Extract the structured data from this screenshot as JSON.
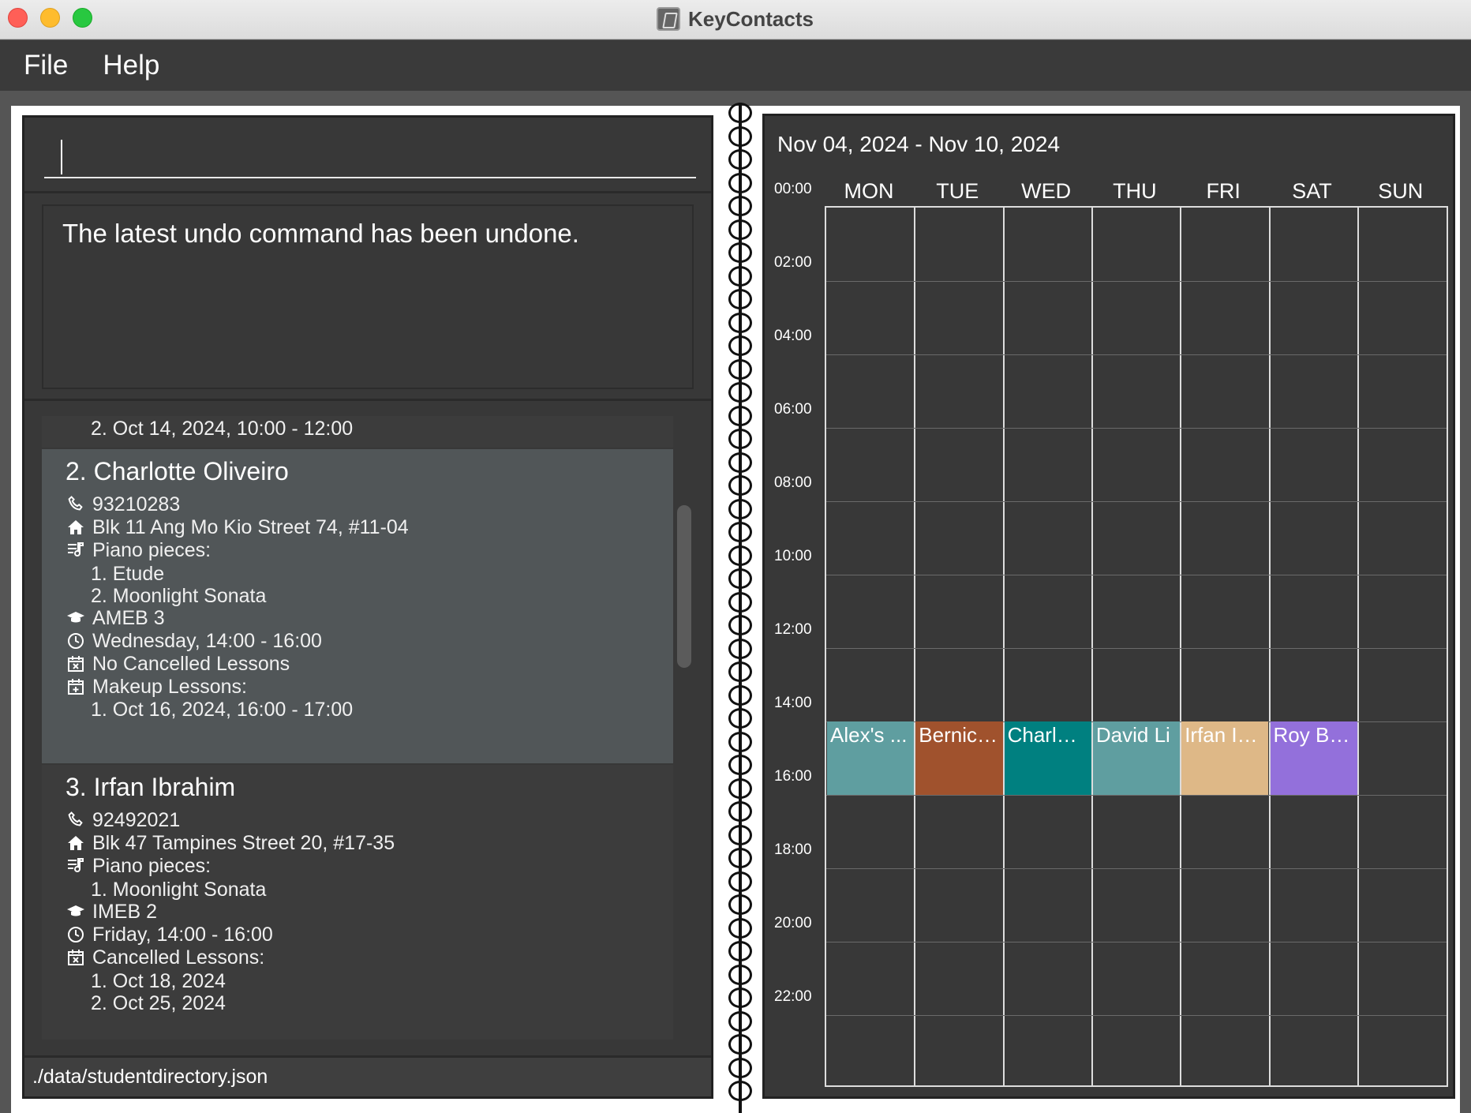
{
  "window": {
    "title": "KeyContacts"
  },
  "menu": {
    "file": "File",
    "help": "Help"
  },
  "command": {
    "value": "",
    "placeholder": ""
  },
  "result": {
    "message": "The latest undo command has been undone."
  },
  "list": {
    "prev_tail": "2. Oct 14, 2024, 10:00 - 12:00",
    "students": [
      {
        "title": "2. Charlotte Oliveiro",
        "phone": "93210283",
        "address": "Blk 11 Ang Mo Kio Street 74, #11-04",
        "pieces_label": "Piano pieces:",
        "pieces": [
          "1. Etude",
          "2. Moonlight Sonata"
        ],
        "grade": "AMEB 3",
        "lesson": "Wednesday, 14:00 - 16:00",
        "cancelled_label": "No Cancelled Lessons",
        "makeup_label": "Makeup Lessons:",
        "makeup": [
          "1. Oct 16, 2024, 16:00 - 17:00"
        ]
      },
      {
        "title": "3. Irfan Ibrahim",
        "phone": "92492021",
        "address": "Blk 47 Tampines Street 20, #17-35",
        "pieces_label": "Piano pieces:",
        "pieces": [
          "1. Moonlight Sonata"
        ],
        "grade": "IMEB 2",
        "lesson": "Friday, 14:00 - 16:00",
        "cancelled_label": "Cancelled Lessons:",
        "cancelled": [
          "1. Oct 18, 2024",
          "2. Oct 25, 2024"
        ]
      }
    ]
  },
  "status": {
    "path": "./data/studentdirectory.json"
  },
  "calendar": {
    "range": "Nov 04, 2024 - Nov 10, 2024",
    "days": [
      "MON",
      "TUE",
      "WED",
      "THU",
      "FRI",
      "SAT",
      "SUN"
    ],
    "times": [
      "00:00",
      "02:00",
      "04:00",
      "06:00",
      "08:00",
      "10:00",
      "12:00",
      "14:00",
      "16:00",
      "18:00",
      "20:00",
      "22:00"
    ],
    "events": [
      {
        "day": 0,
        "label": "Alex's ...",
        "color": "#5f9ea0"
      },
      {
        "day": 1,
        "label": "Bernice...",
        "color": "#a0522d"
      },
      {
        "day": 2,
        "label": "Charlot...",
        "color": "#008080"
      },
      {
        "day": 3,
        "label": "David Li",
        "color": "#5f9ea0"
      },
      {
        "day": 4,
        "label": "Irfan Ibr...",
        "color": "#deb887"
      },
      {
        "day": 5,
        "label": "Roy Bal...",
        "color": "#9370db"
      }
    ]
  },
  "icons": {
    "phone": "phone-icon",
    "home": "home-icon",
    "music": "music-list-icon",
    "grade": "graduation-cap-icon",
    "time": "clock-icon",
    "cancel": "calendar-x-icon",
    "makeup": "calendar-plus-icon"
  }
}
